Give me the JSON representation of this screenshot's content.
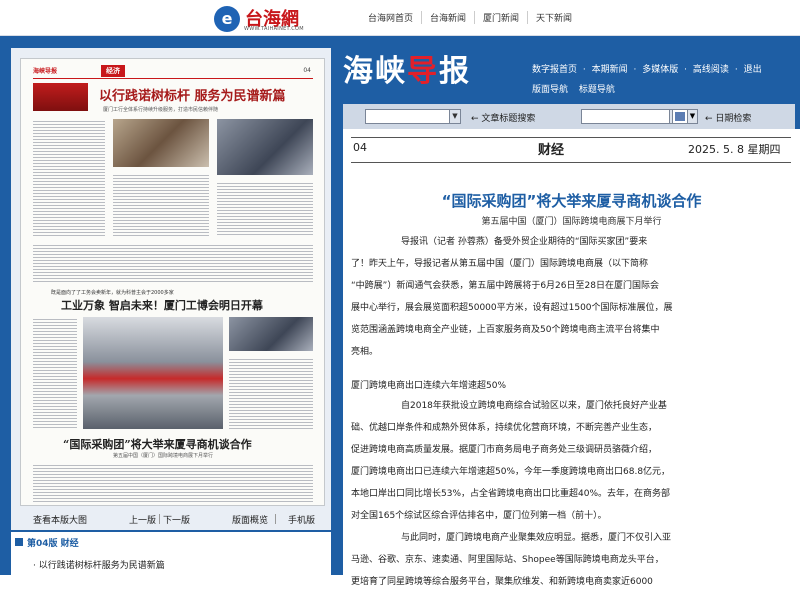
{
  "site": {
    "logo_text": "台海網",
    "logo_sub": "WWW.TAIHAINET.COM",
    "nav": [
      "台海网首页",
      "台海新闻",
      "厦门新闻",
      "天下新闻"
    ]
  },
  "masthead": {
    "name_left": "海峡",
    "name_accent": "导",
    "name_right": "报",
    "menu_row1": [
      "数字报首页",
      "·",
      "本期新闻",
      "·",
      "多媒体版",
      "·",
      "高线阅读",
      "·",
      "退出"
    ],
    "menu_row2": [
      "版面导航",
      "标题导航"
    ]
  },
  "search": {
    "article_search_label": "← 文章标题搜索",
    "date_search_label": "← 日期检索"
  },
  "paper_preview": {
    "header_logo": "海峡导报",
    "section_tag": "经济",
    "page_number": "04",
    "headline1": "以行践诺树标杆 服务为民谱新篇",
    "headline1_sub": "厦门工行全体系行持续升级服务，打造市民信赖伴随",
    "banner_sub": "既是面向了了工务会卖新年，就为科普主会于2000多家",
    "headline2": "工业万象 智启未来！厦门工博会明日开幕",
    "headline3": "“国际采购团”将大举来厦寻商机谈合作",
    "headline3_sub": "第五届中国（厦门）国际跨境电商展下月举行"
  },
  "page_nav": {
    "view_large": "查看本版大图",
    "prev": "上一版",
    "next": "下一版",
    "layout_view": "版面概览",
    "mobile": "手机版"
  },
  "section": {
    "label": "第04版  财经"
  },
  "article_list": [
    "· 以行践诺树标杆服务为民谱新篇"
  ],
  "article": {
    "page": "04",
    "section": "财经",
    "date": "2025. 5. 8  星期四",
    "title": "“国际采购团”将大举来厦寻商机谈合作",
    "subtitle": "第五届中国（厦门）国际跨境电商展下月举行",
    "p1_lines": [
      "导报讯（记者  孙蓉燕）备受外贸企业期待的“国际买家团”要来",
      "了！昨天上午，导报记者从第五届中国（厦门）国际跨境电商展（以下简称",
      "“中跨展”）新闻通气会获悉，第五届中跨展将于6月26日至28日在厦门国际会",
      "展中心举行，展会展览面积超50000平方米，设有超过1500个国际标准展位，展",
      "览范围涵盖跨境电商全产业链，上百家服务商及50个跨境电商主流平台将集中",
      "亮相。"
    ],
    "subhead": "厦门跨境电商出口连续六年增速超50%",
    "p2_lines": [
      "自2018年获批设立跨境电商综合试验区以来，厦门依托良好产业基",
      "础、优越口岸条件和成熟外贸体系，持续优化营商环境，不断完善产业生态，",
      "促进跨境电商高质量发展。据厦门市商务局电子商务处三级调研员骆薇介绍，",
      "厦门跨境电商出口已连续六年增速超50%，今年一季度跨境电商出口68.8亿元，",
      "本地口岸出口同比增长53%，占全省跨境电商出口比重超40%。去年，在商务部",
      "对全国165个综试区综合评估排名中，厦门位列第一档（前十）。"
    ],
    "p3_lines": [
      "与此同时，厦门跨境电商产业聚集效应明显。据悉，厦门不仅引入亚",
      "马逊、谷歌、京东、速卖通、阿里国际站、Shopee等国际跨境电商龙头平台，",
      "更培育了同星跨境等综合服务平台，聚集欣维发、和新跨境电商卖家近6000"
    ]
  }
}
